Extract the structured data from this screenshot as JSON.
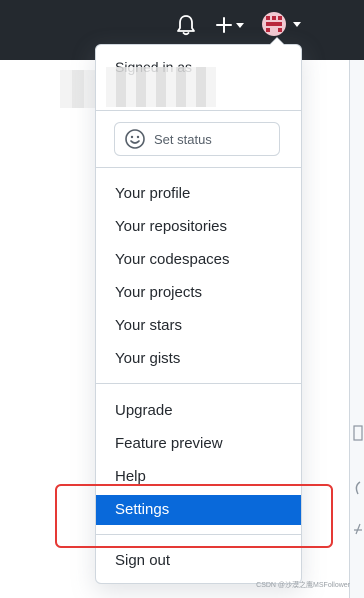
{
  "header": {
    "bell_icon": "bell-icon",
    "plus_icon": "plus-icon",
    "caret_icon": "chevron-down-icon",
    "avatar_icon": "user-avatar"
  },
  "menu": {
    "signed_in_label": "Signed in as",
    "status_button": {
      "icon": "smiley-icon",
      "label": "Set status"
    },
    "section_profile": [
      {
        "label": "Your profile"
      },
      {
        "label": "Your repositories"
      },
      {
        "label": "Your codespaces"
      },
      {
        "label": "Your projects"
      },
      {
        "label": "Your stars"
      },
      {
        "label": "Your gists"
      }
    ],
    "section_settings": [
      {
        "label": "Upgrade"
      },
      {
        "label": "Feature preview"
      },
      {
        "label": "Help"
      },
      {
        "label": "Settings",
        "active": true
      }
    ],
    "sign_out_label": "Sign out"
  },
  "watermark": "CSDN @沙漠之鹰MSFollower",
  "colors": {
    "header_bg": "#24292f",
    "highlight": "#0969da",
    "annotation": "#e53935"
  }
}
